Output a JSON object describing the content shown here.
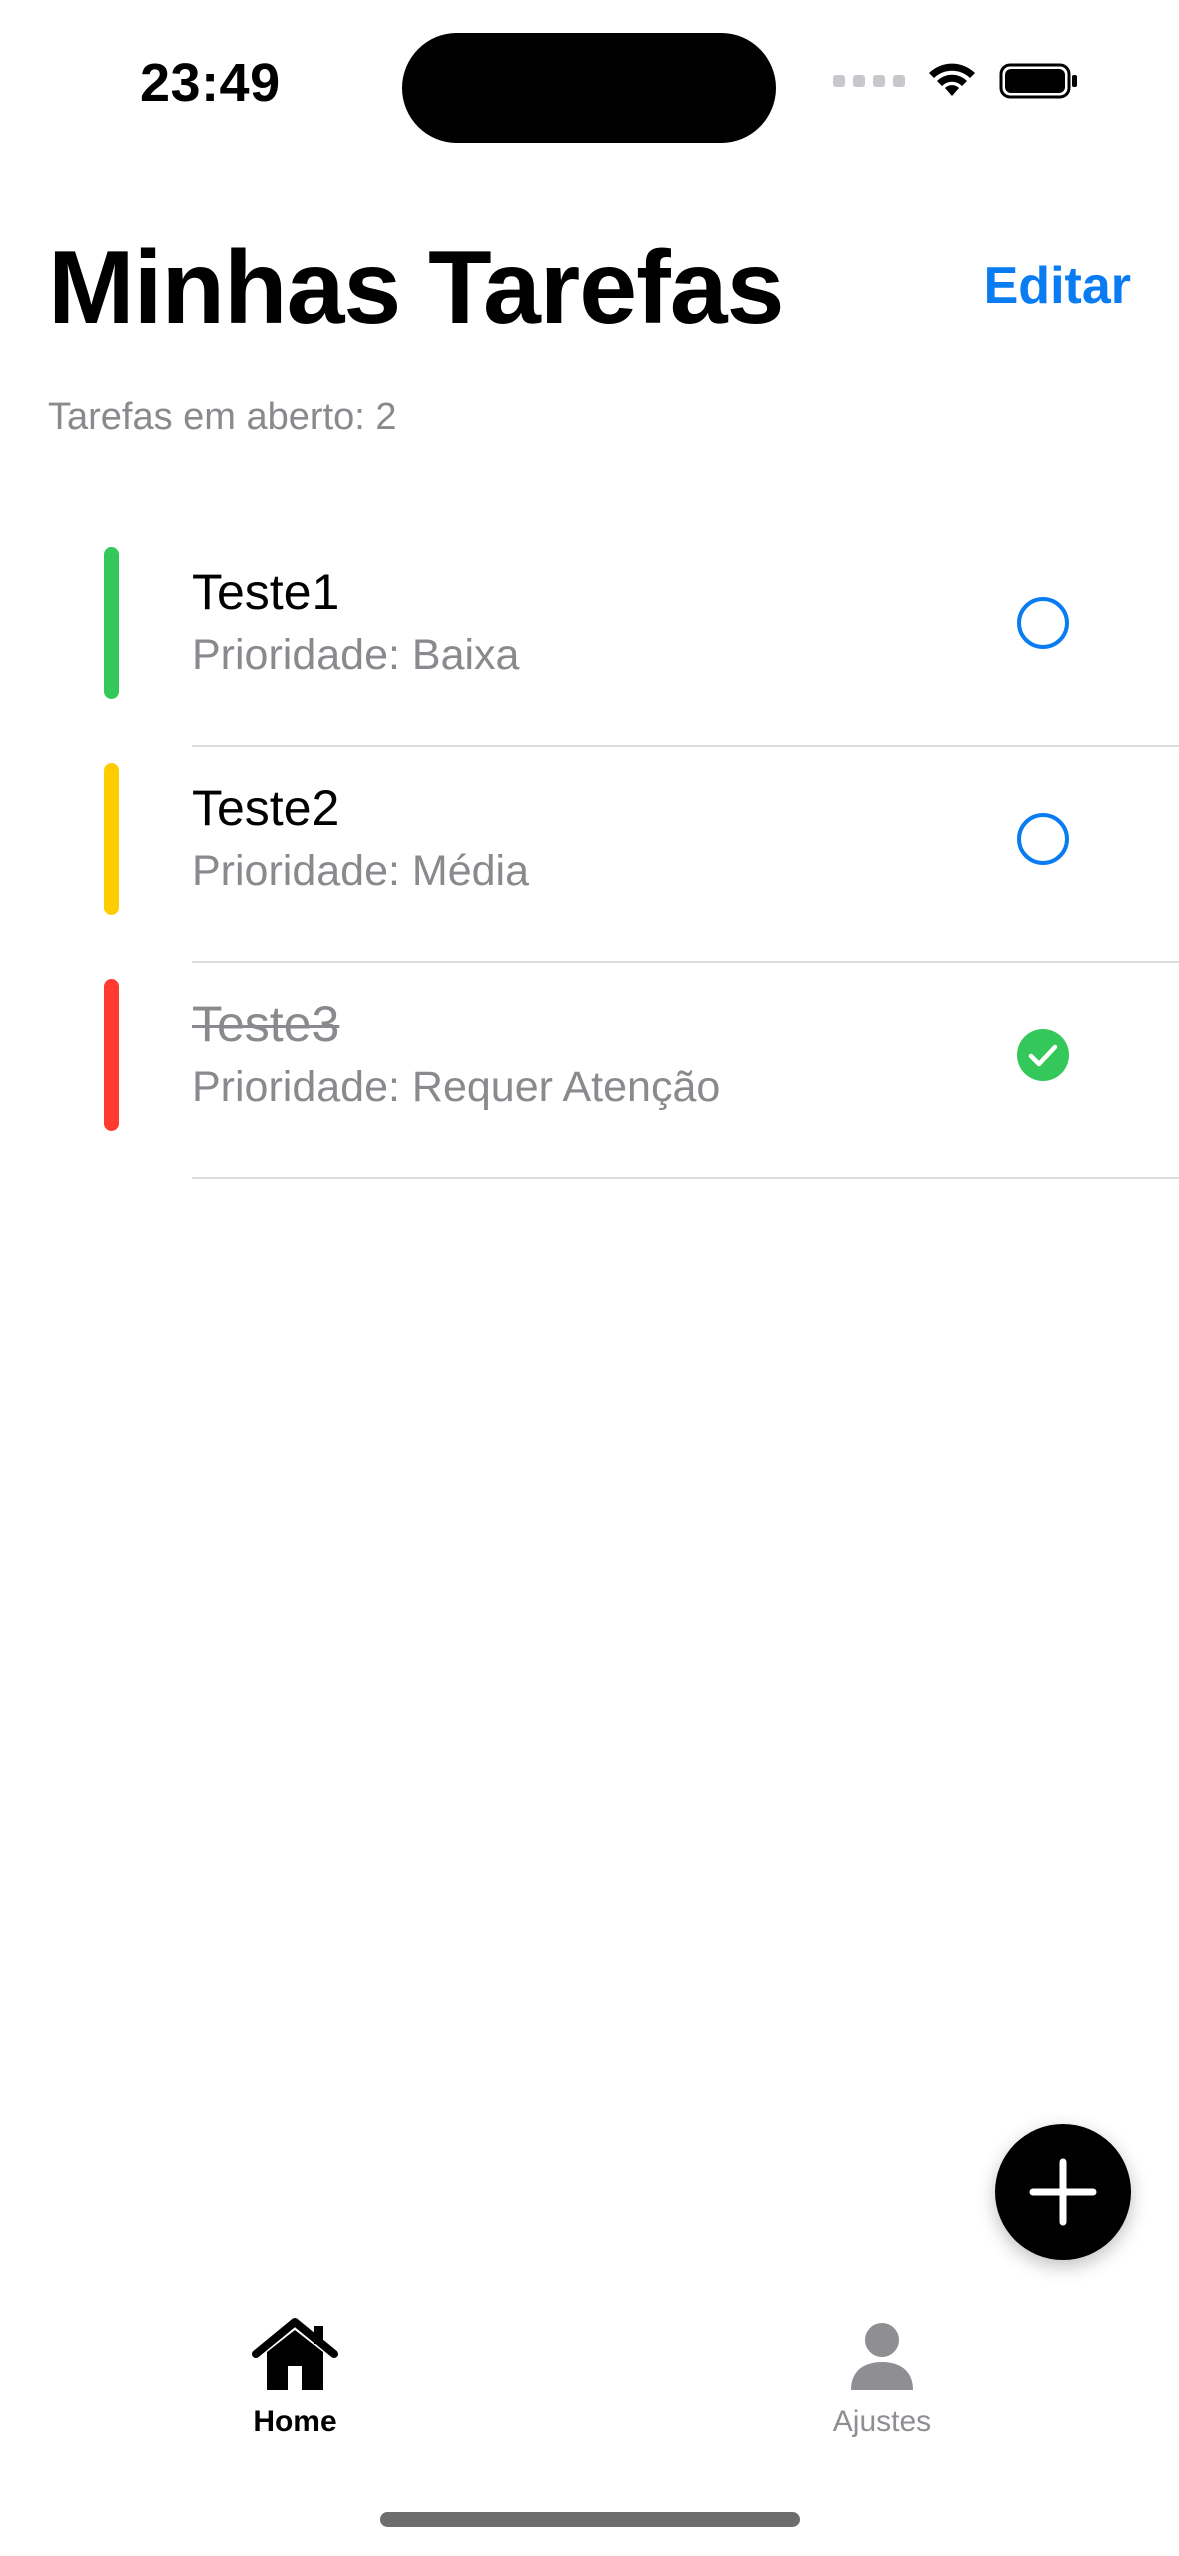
{
  "status_bar": {
    "time": "23:49",
    "icons": [
      "cellular-signal-icon",
      "wifi-icon",
      "battery-icon"
    ]
  },
  "header": {
    "title": "Minhas Tarefas",
    "edit_label": "Editar",
    "open_tasks_text": "Tarefas em aberto: 2"
  },
  "colors": {
    "accent": "#0a7cf2",
    "low": "#34c759",
    "medium": "#ffcc00",
    "attention": "#ff3b30",
    "secondary_text": "#8a8a8e"
  },
  "tasks": [
    {
      "title": "Teste1",
      "priority": "Prioridade: Baixa",
      "priority_color": "#34c759",
      "done": false
    },
    {
      "title": "Teste2",
      "priority": "Prioridade: Média",
      "priority_color": "#ffcc00",
      "done": false
    },
    {
      "title": "Teste3",
      "priority": "Prioridade: Requer Atenção",
      "priority_color": "#ff3b30",
      "done": true
    }
  ],
  "fab": {
    "icon": "plus-icon"
  },
  "tab_bar": {
    "home_label": "Home",
    "home_icon": "house-icon",
    "settings_label": "Ajustes",
    "settings_icon": "person-icon",
    "selected": "Home"
  }
}
